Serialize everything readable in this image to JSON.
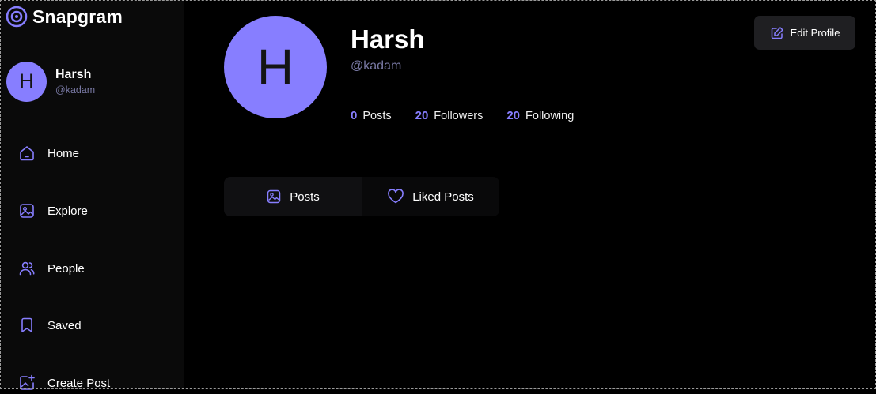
{
  "app": {
    "name": "Snapgram",
    "icon": "snapgram-logo-icon"
  },
  "user": {
    "name": "Harsh",
    "handle": "@kadam",
    "initial": "H"
  },
  "sidebar": {
    "items": [
      {
        "label": "Home",
        "icon": "home-icon"
      },
      {
        "label": "Explore",
        "icon": "explore-icon"
      },
      {
        "label": "People",
        "icon": "people-icon"
      },
      {
        "label": "Saved",
        "icon": "saved-icon"
      },
      {
        "label": "Create Post",
        "icon": "create-post-icon"
      }
    ]
  },
  "profile": {
    "name": "Harsh",
    "handle": "@kadam",
    "initial": "H",
    "edit_label": "Edit Profile",
    "stats": [
      {
        "value": "0",
        "label": "Posts"
      },
      {
        "value": "20",
        "label": "Followers"
      },
      {
        "value": "20",
        "label": "Following"
      }
    ],
    "tabs": [
      {
        "label": "Posts",
        "icon": "posts-icon",
        "active": true
      },
      {
        "label": "Liked Posts",
        "icon": "heart-icon",
        "active": false
      }
    ]
  },
  "colors": {
    "accent": "#877eff",
    "background": "#000000",
    "sidebar": "#0a0a0a",
    "muted": "#7878a3"
  }
}
